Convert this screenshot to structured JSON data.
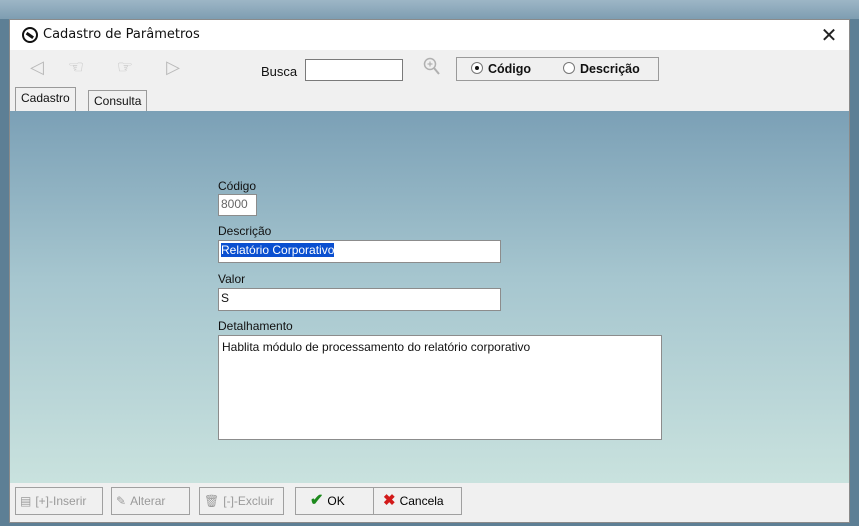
{
  "window": {
    "title": "Cadastro de Parâmetros",
    "close_glyph": "✕"
  },
  "toolbar": {
    "nav": [
      {
        "name": "first-record-icon",
        "glyph": "◁"
      },
      {
        "name": "previous-record-icon",
        "glyph": "☜"
      },
      {
        "name": "next-record-icon",
        "glyph": "☞"
      },
      {
        "name": "last-record-icon",
        "glyph": "▷"
      }
    ],
    "search_label": "Busca",
    "search_value": "",
    "radio_codigo": "Código",
    "radio_descricao": "Descrição",
    "selected": "Código"
  },
  "tabs": {
    "cadastro": "Cadastro",
    "consulta": "Consulta"
  },
  "form": {
    "codigo_label": "Código",
    "codigo_value": "8000",
    "descricao_label": "Descrição",
    "descricao_value": "Relatório Corporativo",
    "valor_label": "Valor",
    "valor_value": "S",
    "detalhamento_label": "Detalhamento",
    "detalhamento_value": "Hablita módulo de processamento do relatório corporativo"
  },
  "buttons": {
    "inserir": "[+]-Inserir",
    "alterar": "Alterar",
    "excluir": "[-]-Excluir",
    "ok": "OK",
    "cancela": "Cancela"
  },
  "colors": {
    "ok_green": "#1d8a1d",
    "cancel_red": "#d21a1a",
    "selection_blue": "#0a4fd0"
  }
}
